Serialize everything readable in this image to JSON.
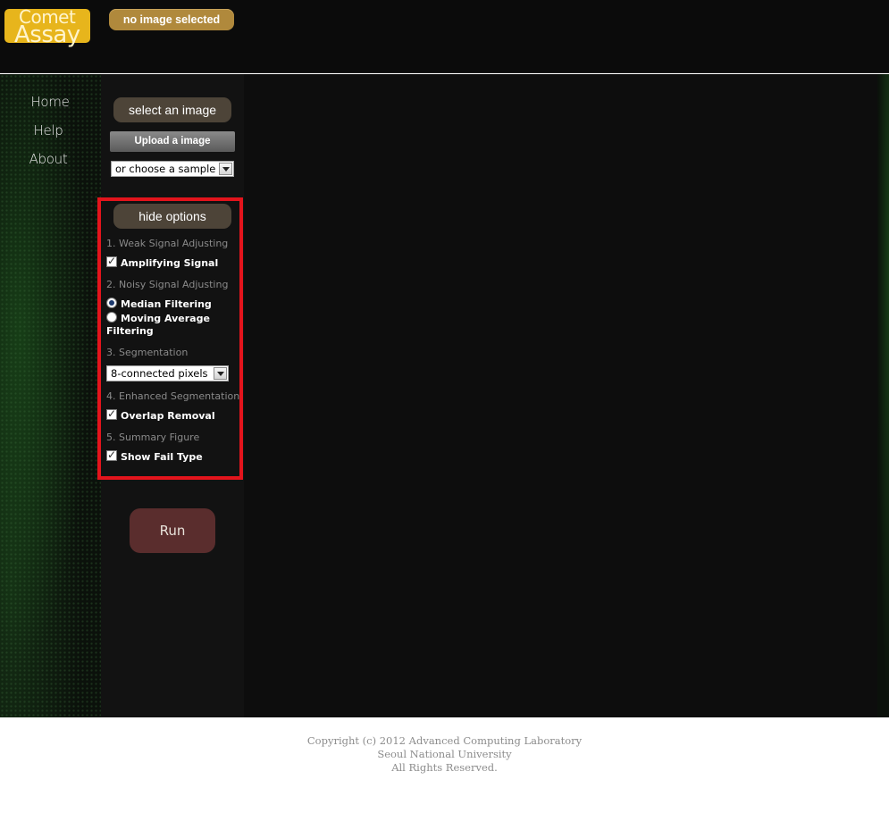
{
  "header": {
    "logo_line1": "Comet",
    "logo_line2": "Assay",
    "status_badge": "no image selected"
  },
  "nav": {
    "items": [
      {
        "label": "Home"
      },
      {
        "label": "Help"
      },
      {
        "label": "About"
      }
    ]
  },
  "sidebar": {
    "select_image_label": "select an image",
    "upload_label": "Upload a image",
    "sample_select_value": "or choose a sample",
    "hide_options_label": "hide options",
    "options": {
      "s1_heading": "1. Weak Signal Adjusting",
      "s1_checkbox": "Amplifying Signal",
      "s2_heading": "2. Noisy Signal Adjusting",
      "s2_radio1": "Median Filtering",
      "s2_radio2_line1": "Moving Average",
      "s2_radio2_line2": "Filtering",
      "s3_heading": "3. Segmentation",
      "s3_select_value": "8-connected pixels",
      "s4_heading": "4. Enhanced Segmentation",
      "s4_checkbox": "Overlap Removal",
      "s5_heading": "5. Summary Figure",
      "s5_checkbox": "Show Fail Type"
    },
    "run_label": "Run"
  },
  "footer": {
    "line1": "Copyright (c) 2012 Advanced Computing Laboratory",
    "line2": "Seoul National University",
    "line3": "All Rights Reserved."
  },
  "colors": {
    "logo": "#e7b51c",
    "status_badge": "#b0893c",
    "pill_button": "#4d4438",
    "run_button": "#5a2d2d",
    "highlight_border": "#e3141c"
  }
}
